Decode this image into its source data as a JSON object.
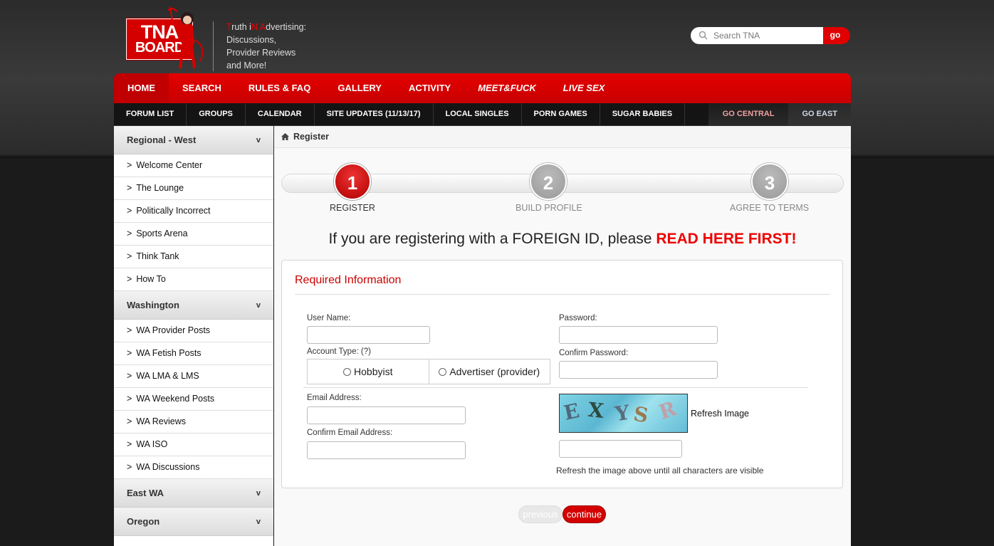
{
  "header": {
    "logo_top": "TNA",
    "logo_bottom": "BOARD",
    "tagline": {
      "line1_parts": [
        "T",
        "ruth i",
        "N",
        " ",
        "A",
        "dvertising:"
      ],
      "line2": "Discussions,",
      "line3": "Provider Reviews",
      "line4": "and More!"
    },
    "search": {
      "placeholder": "Search TNA",
      "button": "go"
    }
  },
  "nav_main": [
    {
      "label": "HOME",
      "active": true
    },
    {
      "label": "SEARCH"
    },
    {
      "label": "RULES & FAQ"
    },
    {
      "label": "GALLERY"
    },
    {
      "label": "ACTIVITY"
    },
    {
      "label": "MEET&FUCK",
      "italic": true
    },
    {
      "label": "LIVE SEX",
      "italic": true
    }
  ],
  "nav_sub": [
    "FORUM LIST",
    "GROUPS",
    "CALENDAR",
    "SITE UPDATES (11/13/17)",
    "LOCAL SINGLES",
    "PORN GAMES",
    "SUGAR BABIES"
  ],
  "nav_sub_right": [
    "GO CENTRAL",
    "GO EAST"
  ],
  "sidebar": {
    "chevron": "v",
    "groups": [
      {
        "title": "Regional - West",
        "items": [
          "Welcome Center",
          "The Lounge",
          "Politically Incorrect",
          "Sports Arena",
          "Think Tank",
          "How To"
        ]
      },
      {
        "title": "Washington",
        "items": [
          "WA Provider Posts",
          "WA Fetish Posts",
          "WA LMA & LMS",
          "WA Weekend Posts",
          "WA Reviews",
          "WA ISO",
          "WA Discussions"
        ]
      },
      {
        "title": "East WA",
        "items": []
      },
      {
        "title": "Oregon",
        "items": []
      }
    ]
  },
  "breadcrumb": "Register",
  "steps": [
    {
      "num": "1",
      "label": "REGISTER",
      "active": true
    },
    {
      "num": "2",
      "label": "BUILD PROFILE"
    },
    {
      "num": "3",
      "label": "AGREE TO TERMS"
    }
  ],
  "foreign": {
    "text": "If you are registering with a FOREIGN ID, please ",
    "link": "READ HERE FIRST!"
  },
  "form": {
    "title": "Required Information",
    "username_label": "User Name:",
    "password_label": "Password:",
    "account_type_label": "Account Type: (?)",
    "confirm_password_label": "Confirm Password:",
    "account_options": [
      "Hobbyist",
      "Advertiser (provider)"
    ],
    "email_label": "Email Address:",
    "confirm_email_label": "Confirm Email Address:",
    "captcha_chars": [
      "E",
      "X",
      "Y",
      "S",
      "R"
    ],
    "refresh_image": "Refresh Image",
    "captcha_hint": "Refresh the image above until all characters are visible"
  },
  "buttons": {
    "previous": "previous",
    "continue": "continue"
  }
}
